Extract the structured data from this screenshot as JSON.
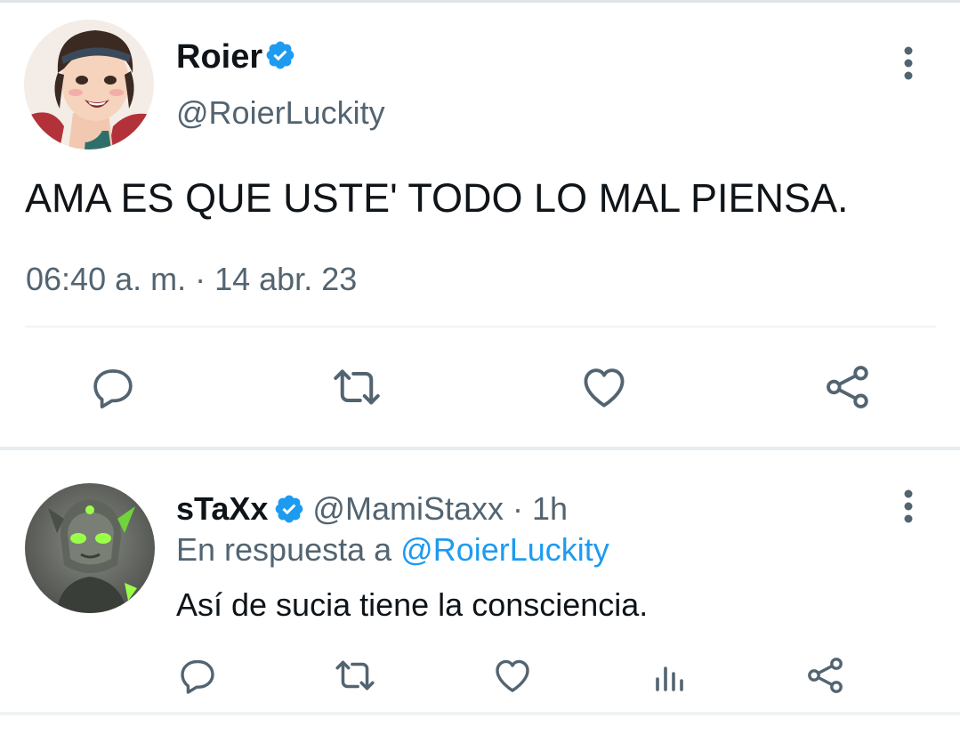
{
  "colors": {
    "text_primary": "#0f1419",
    "text_secondary": "#536471",
    "accent": "#1d9bf0",
    "icon": "#536471"
  },
  "main_tweet": {
    "author_name": "Roier",
    "author_handle": "@RoierLuckity",
    "verified": true,
    "text": "AMA ES QUE USTE' TODO LO MAL PIENSA.",
    "meta": "06:40 a. m. · 14 abr. 23",
    "actions": [
      "reply-icon",
      "retweet-icon",
      "like-icon",
      "share-icon"
    ]
  },
  "reply_tweet": {
    "author_name": "sTaXx",
    "author_handle": "@MamiStaxx",
    "separator": " · ",
    "time": "1h",
    "verified": true,
    "reply_prefix": "En respuesta a ",
    "reply_mention": "@RoierLuckity",
    "text": "Así de sucia tiene la consciencia.",
    "actions": [
      "reply-icon",
      "retweet-icon",
      "like-icon",
      "analytics-icon",
      "share-icon"
    ]
  }
}
